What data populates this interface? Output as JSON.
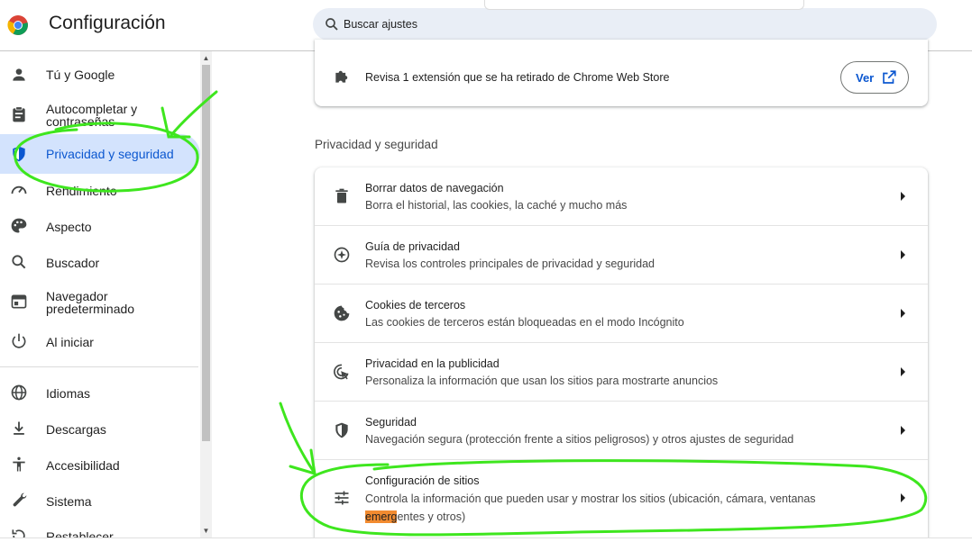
{
  "header": {
    "title": "Configuración",
    "search_placeholder": "Buscar ajustes"
  },
  "sidebar": {
    "items": [
      {
        "label": "Tú y Google",
        "icon": "person-icon"
      },
      {
        "label": "Autocompletar y contraseñas",
        "icon": "clipboard-icon"
      },
      {
        "label": "Privacidad y seguridad",
        "icon": "shield-icon",
        "active": true
      },
      {
        "label": "Rendimiento",
        "icon": "speedometer-icon"
      },
      {
        "label": "Aspecto",
        "icon": "palette-icon"
      },
      {
        "label": "Buscador",
        "icon": "search-icon"
      },
      {
        "label": "Navegador predeterminado",
        "icon": "browser-icon"
      },
      {
        "label": "Al iniciar",
        "icon": "power-icon"
      },
      {
        "label": "Idiomas",
        "icon": "globe-icon"
      },
      {
        "label": "Descargas",
        "icon": "download-icon"
      },
      {
        "label": "Accesibilidad",
        "icon": "accessibility-icon"
      },
      {
        "label": "Sistema",
        "icon": "wrench-icon"
      },
      {
        "label": "Restablecer configuración",
        "icon": "reset-icon"
      }
    ]
  },
  "extension_notice": {
    "text": "Revisa 1 extensión que se ha retirado de Chrome Web Store",
    "button_label": "Ver"
  },
  "section": {
    "title": "Privacidad y seguridad",
    "rows": [
      {
        "title": "Borrar datos de navegación",
        "subtitle": "Borra el historial, las cookies, la caché y mucho más",
        "icon": "trash-icon"
      },
      {
        "title": "Guía de privacidad",
        "subtitle": "Revisa los controles principales de privacidad y seguridad",
        "icon": "compass-icon"
      },
      {
        "title": "Cookies de terceros",
        "subtitle": "Las cookies de terceros están bloqueadas en el modo Incógnito",
        "icon": "cookie-icon"
      },
      {
        "title": "Privacidad en la publicidad",
        "subtitle": "Personaliza la información que usan los sitios para mostrarte anuncios",
        "icon": "ad-privacy-icon"
      },
      {
        "title": "Seguridad",
        "subtitle": "Navegación segura (protección frente a sitios peligrosos) y otros ajustes de seguridad",
        "icon": "shield-icon"
      },
      {
        "title": "Configuración de sitios",
        "subtitle_pre": "Controla la información que pueden usar y mostrar los sitios (ubicación, cámara, ventanas ",
        "subtitle_hl": "emerg",
        "subtitle_post": "entes y otros)",
        "icon": "sliders-icon"
      }
    ]
  },
  "colors": {
    "accent": "#0b57d0",
    "active_bg": "#d3e3fd",
    "annotation": "#3ee61e",
    "highlight": "#f28b30"
  }
}
